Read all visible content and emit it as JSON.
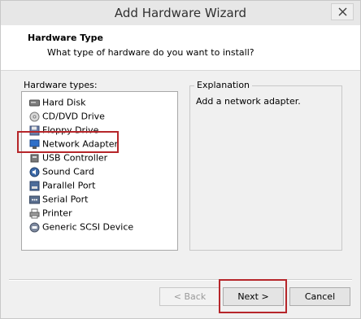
{
  "window": {
    "title": "Add Hardware Wizard"
  },
  "header": {
    "title": "Hardware Type",
    "subtitle": "What type of hardware do you want to install?"
  },
  "hardware": {
    "label": "Hardware types:",
    "selected": "Network Adapter",
    "items": [
      {
        "label": "Hard Disk",
        "icon": "hard-disk-icon"
      },
      {
        "label": "CD/DVD Drive",
        "icon": "cd-dvd-icon"
      },
      {
        "label": "Floppy Drive",
        "icon": "floppy-icon"
      },
      {
        "label": "Network Adapter",
        "icon": "network-adapter-icon"
      },
      {
        "label": "USB Controller",
        "icon": "usb-icon"
      },
      {
        "label": "Sound Card",
        "icon": "sound-card-icon"
      },
      {
        "label": "Parallel Port",
        "icon": "parallel-port-icon"
      },
      {
        "label": "Serial Port",
        "icon": "serial-port-icon"
      },
      {
        "label": "Printer",
        "icon": "printer-icon"
      },
      {
        "label": "Generic SCSI Device",
        "icon": "scsi-device-icon"
      }
    ]
  },
  "explanation": {
    "label": "Explanation",
    "text": "Add a network adapter."
  },
  "buttons": {
    "back": "< Back",
    "next": "Next >",
    "cancel": "Cancel"
  },
  "colors": {
    "callout": "#b6262a",
    "window_bg": "#f0f0f0"
  }
}
